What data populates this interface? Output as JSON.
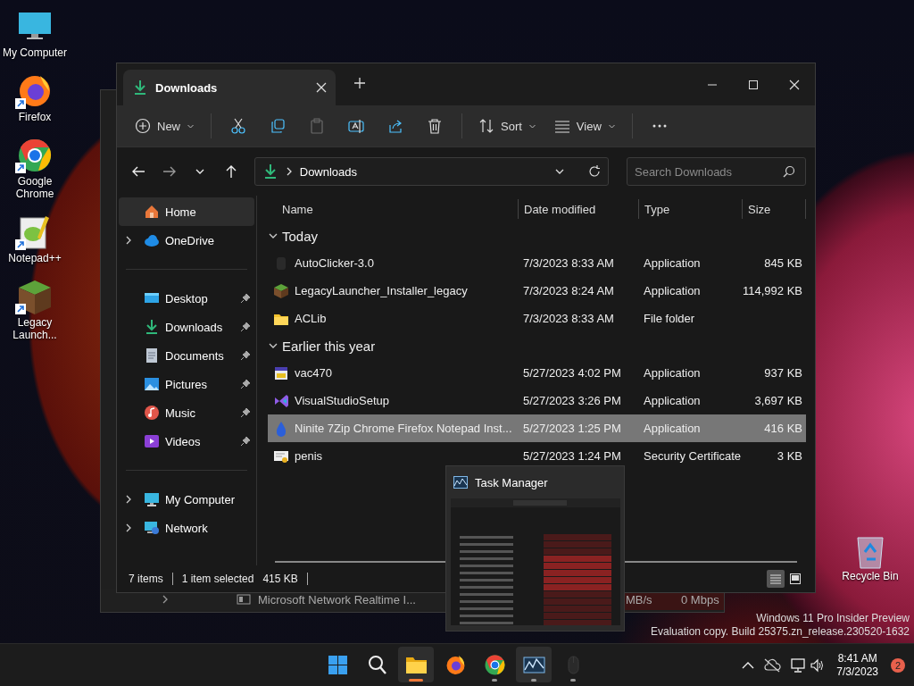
{
  "desktop_icons": [
    {
      "label": "My Computer",
      "kind": "computer",
      "shortcut": false
    },
    {
      "label": "Firefox",
      "kind": "firefox",
      "shortcut": true
    },
    {
      "label": "Google Chrome",
      "kind": "chrome",
      "shortcut": true
    },
    {
      "label": "Notepad++",
      "kind": "notepad",
      "shortcut": true
    },
    {
      "label": "Legacy Launch...",
      "kind": "cube",
      "shortcut": true
    }
  ],
  "recycle_bin": {
    "label": "Recycle Bin"
  },
  "background_window": {
    "row": {
      "name": "Microsoft Network Realtime I...",
      "column_2": "MB/s",
      "column_3": "0 Mbps"
    }
  },
  "explorer": {
    "tab": {
      "title": "Downloads"
    },
    "toolbar": [
      {
        "kind": "new",
        "label": "New",
        "disabled": false
      },
      {
        "kind": "cut",
        "disabled": false
      },
      {
        "kind": "copy",
        "disabled": false
      },
      {
        "kind": "paste",
        "disabled": true
      },
      {
        "kind": "rename",
        "disabled": false
      },
      {
        "kind": "share",
        "disabled": false
      },
      {
        "kind": "delete",
        "disabled": false
      },
      {
        "kind": "sort",
        "label": "Sort",
        "disabled": false
      },
      {
        "kind": "view",
        "label": "View",
        "disabled": false
      },
      {
        "kind": "more",
        "disabled": false
      }
    ],
    "address": {
      "location": "Downloads"
    },
    "search": {
      "placeholder": "Search Downloads"
    },
    "sidebar": [
      [
        {
          "label": "Home",
          "kind": "home",
          "expandable": false,
          "pinned": false,
          "selected": true
        },
        {
          "label": "OneDrive",
          "kind": "cloud",
          "expandable": true,
          "pinned": false,
          "selected": false
        }
      ],
      [
        {
          "label": "Desktop",
          "kind": "desktop",
          "expandable": false,
          "pinned": true,
          "selected": false
        },
        {
          "label": "Downloads",
          "kind": "download",
          "expandable": false,
          "pinned": true,
          "selected": false
        },
        {
          "label": "Documents",
          "kind": "document",
          "expandable": false,
          "pinned": true,
          "selected": false
        },
        {
          "label": "Pictures",
          "kind": "pictures",
          "expandable": false,
          "pinned": true,
          "selected": false
        },
        {
          "label": "Music",
          "kind": "music",
          "expandable": false,
          "pinned": true,
          "selected": false
        },
        {
          "label": "Videos",
          "kind": "videos",
          "expandable": false,
          "pinned": true,
          "selected": false
        }
      ],
      [
        {
          "label": "My Computer",
          "kind": "computer",
          "expandable": true,
          "pinned": false,
          "selected": false
        },
        {
          "label": "Network",
          "kind": "network",
          "expandable": true,
          "pinned": false,
          "selected": false
        }
      ]
    ],
    "columns": [
      "Name",
      "Date modified",
      "Type",
      "Size"
    ],
    "groups": [
      {
        "label": "Today",
        "expanded": true,
        "files": [
          {
            "name": "AutoClicker-3.0",
            "kind": "blank",
            "date": "7/3/2023 8:33 AM",
            "type": "Application",
            "size": "845 KB",
            "selected": false
          },
          {
            "name": "LegacyLauncher_Installer_legacy",
            "kind": "cube",
            "date": "7/3/2023 8:24 AM",
            "type": "Application",
            "size": "114,992 KB",
            "selected": false
          },
          {
            "name": "ACLib",
            "kind": "folder",
            "date": "7/3/2023 8:33 AM",
            "type": "File folder",
            "selected": false
          }
        ]
      },
      {
        "label": "Earlier this year",
        "expanded": true,
        "files": [
          {
            "name": "vac470",
            "kind": "installer",
            "date": "5/27/2023 4:02 PM",
            "type": "Application",
            "size": "937 KB",
            "selected": false
          },
          {
            "name": "VisualStudioSetup",
            "kind": "vs",
            "date": "5/27/2023 3:26 PM",
            "type": "Application",
            "size": "3,697 KB",
            "selected": false
          },
          {
            "name": "Ninite 7Zip Chrome Firefox Notepad Inst...",
            "kind": "drop",
            "date": "5/27/2023 1:25 PM",
            "type": "Application",
            "size": "416 KB",
            "selected": true
          },
          {
            "name": "penis",
            "kind": "certificate",
            "date": "5/27/2023 1:24 PM",
            "type": "Security Certificate",
            "size": "3 KB",
            "selected": false
          }
        ]
      }
    ],
    "status": {
      "count": "7 items",
      "selection": "1 item selected",
      "selection_size": "415 KB"
    },
    "views": [
      {
        "kind": "details",
        "selected": true
      },
      {
        "kind": "tiles",
        "selected": false
      }
    ]
  },
  "preview": {
    "title": "Task Manager"
  },
  "watermark": [
    "Windows 11 Pro Insider Preview",
    "Evaluation copy. Build 25375.zn_release.230520-1632"
  ],
  "taskbar": {
    "apps": [
      {
        "kind": "start",
        "running": false,
        "active": false,
        "highlighted": false
      },
      {
        "kind": "search",
        "running": false,
        "active": false,
        "highlighted": false
      },
      {
        "kind": "explorer",
        "running": true,
        "active": true,
        "highlighted": true
      },
      {
        "kind": "firefox",
        "running": false,
        "active": false,
        "highlighted": false
      },
      {
        "kind": "chrome",
        "running": true,
        "active": false,
        "highlighted": false
      },
      {
        "kind": "taskmanager",
        "running": true,
        "active": false,
        "highlighted": true
      },
      {
        "kind": "mouse",
        "running": true,
        "active": false,
        "highlighted": false
      }
    ],
    "clock": {
      "time": "8:41 AM",
      "date": "7/3/2023"
    },
    "notifications": "2"
  }
}
